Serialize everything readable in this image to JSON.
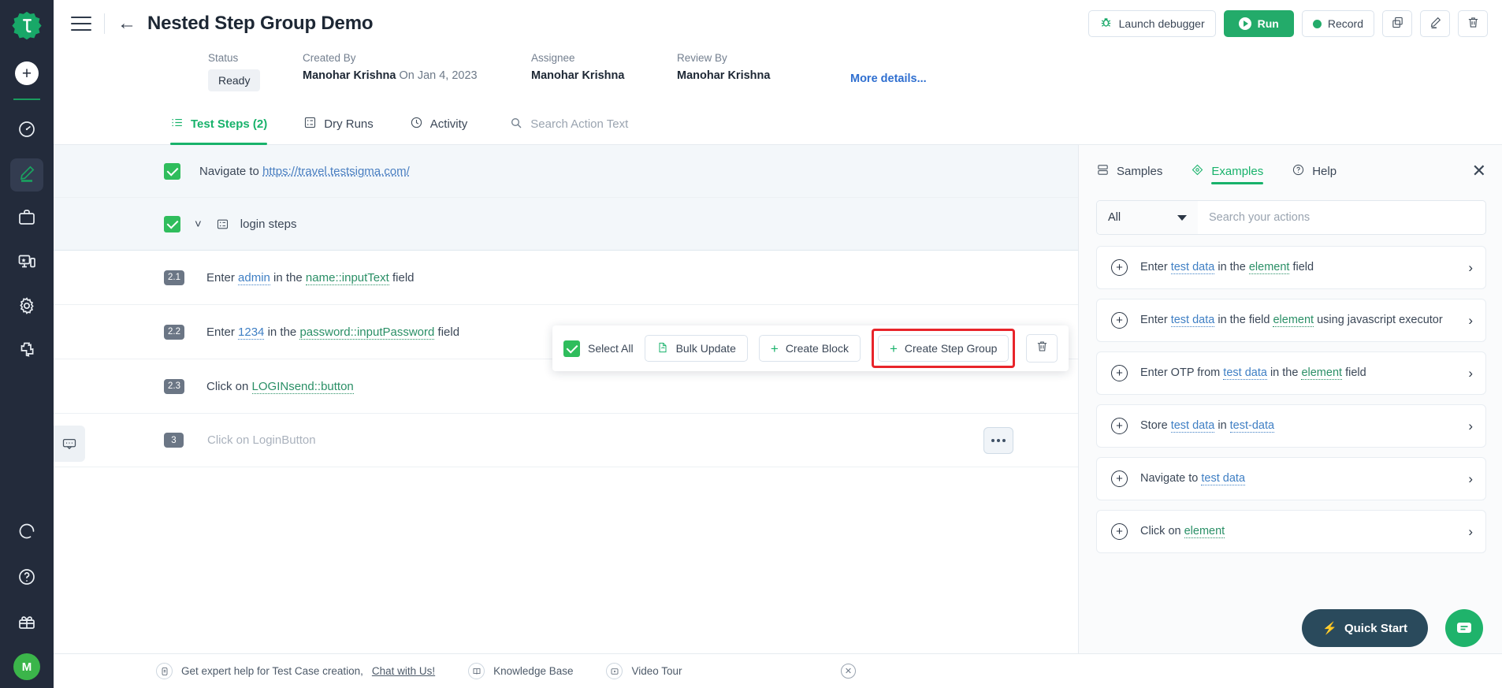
{
  "rail": {
    "logo_icon": "testsigma-logo-icon",
    "add_icon": "plus-icon",
    "items": [
      {
        "name": "dashboard",
        "icon": "speedometer-icon"
      },
      {
        "name": "test-development",
        "icon": "pencil-icon",
        "active": true
      },
      {
        "name": "test-plans",
        "icon": "briefcase-icon"
      },
      {
        "name": "test-lab",
        "icon": "devices-icon"
      },
      {
        "name": "settings",
        "icon": "gear-icon"
      },
      {
        "name": "addons",
        "icon": "puzzle-icon"
      }
    ],
    "bottom_items": [
      {
        "name": "activity",
        "icon": "progress-circle-icon"
      },
      {
        "name": "help",
        "icon": "question-circle-icon"
      },
      {
        "name": "whats-new",
        "icon": "gift-icon"
      }
    ],
    "avatar_initial": "M"
  },
  "header": {
    "title": "Nested Step Group Demo",
    "back_icon": "back-arrow-icon",
    "menu_icon": "hamburger-icon",
    "actions": {
      "launch_debugger": "Launch debugger",
      "run": "Run",
      "record": "Record",
      "copy_icon": "copy-icon",
      "edit_icon": "pencil-edit-icon",
      "delete_icon": "trash-icon"
    }
  },
  "meta": {
    "status_label": "Status",
    "status_value": "Ready",
    "created_by_label": "Created By",
    "created_by_value": "Manohar Krishna",
    "created_on": "On Jan 4, 2023",
    "assignee_label": "Assignee",
    "assignee_value": "Manohar Krishna",
    "review_by_label": "Review By",
    "review_by_value": "Manohar Krishna",
    "more_details": "More details..."
  },
  "tabs": [
    {
      "label": "Test Steps (2)",
      "icon": "list-icon",
      "active": true
    },
    {
      "label": "Dry Runs",
      "icon": "grid-card-icon",
      "active": false
    },
    {
      "label": "Activity",
      "icon": "clock-icon",
      "active": false
    }
  ],
  "search": {
    "placeholder": "Search Action Text",
    "icon": "search-icon"
  },
  "bulkbar": {
    "select_all": "Select All",
    "bulk_update": "Bulk Update",
    "create_block": "Create Block",
    "create_step_group": "Create Step Group",
    "delete_icon": "trash-icon",
    "highlight_color": "#e8242a"
  },
  "steps": [
    {
      "type": "step",
      "checked": true,
      "prefix": "Navigate to",
      "link": "https://travel.testsigma.com/"
    },
    {
      "type": "group",
      "checked": true,
      "expanded": true,
      "chevron_icon": "chevron-down-icon",
      "group_icon": "step-group-icon",
      "label": "login steps"
    },
    {
      "type": "substep",
      "number": "2.1",
      "parts": [
        {
          "t": "Enter ",
          "k": "plain"
        },
        {
          "t": "admin",
          "k": "data"
        },
        {
          "t": " in the ",
          "k": "plain"
        },
        {
          "t": "name::inputText",
          "k": "element"
        },
        {
          "t": " field",
          "k": "plain"
        }
      ]
    },
    {
      "type": "substep",
      "number": "2.2",
      "parts": [
        {
          "t": "Enter ",
          "k": "plain"
        },
        {
          "t": "1234",
          "k": "data"
        },
        {
          "t": " in the ",
          "k": "plain"
        },
        {
          "t": "password::inputPassword",
          "k": "element"
        },
        {
          "t": " field",
          "k": "plain"
        }
      ]
    },
    {
      "type": "substep",
      "number": "2.3",
      "parts": [
        {
          "t": "Click on ",
          "k": "plain"
        },
        {
          "t": "LOGINsend::button",
          "k": "element"
        }
      ]
    },
    {
      "type": "placeholder",
      "number": "3",
      "text": "Click on LoginButton",
      "menu_icon": "more-options-icon"
    }
  ],
  "comment_tab_icon": "comment-icon",
  "right_panel": {
    "tabs": [
      {
        "label": "Samples",
        "icon": "samples-icon",
        "active": false
      },
      {
        "label": "Examples",
        "icon": "examples-icon",
        "active": true
      },
      {
        "label": "Help",
        "icon": "help-circle-icon",
        "active": false
      }
    ],
    "close_icon": "close-icon",
    "filter_value": "All",
    "search_placeholder": "Search your actions",
    "examples": [
      {
        "parts": [
          {
            "t": "Enter ",
            "k": "plain"
          },
          {
            "t": "test data",
            "k": "data"
          },
          {
            "t": " in the ",
            "k": "plain"
          },
          {
            "t": "element",
            "k": "element"
          },
          {
            "t": " field",
            "k": "plain"
          }
        ]
      },
      {
        "parts": [
          {
            "t": "Enter ",
            "k": "plain"
          },
          {
            "t": "test data",
            "k": "data"
          },
          {
            "t": " in the field ",
            "k": "plain"
          },
          {
            "t": "element",
            "k": "element"
          },
          {
            "t": " using javascript executor",
            "k": "plain"
          }
        ]
      },
      {
        "parts": [
          {
            "t": "Enter OTP from ",
            "k": "plain"
          },
          {
            "t": "test data",
            "k": "data"
          },
          {
            "t": " in the ",
            "k": "plain"
          },
          {
            "t": "element",
            "k": "element"
          },
          {
            "t": " field",
            "k": "plain"
          }
        ]
      },
      {
        "parts": [
          {
            "t": "Store ",
            "k": "plain"
          },
          {
            "t": "test data",
            "k": "data"
          },
          {
            "t": " in ",
            "k": "plain"
          },
          {
            "t": "test-data",
            "k": "data"
          }
        ]
      },
      {
        "parts": [
          {
            "t": "Navigate to ",
            "k": "plain"
          },
          {
            "t": "test data",
            "k": "data"
          }
        ]
      },
      {
        "parts": [
          {
            "t": "Click on ",
            "k": "plain"
          },
          {
            "t": "element",
            "k": "element"
          }
        ]
      }
    ]
  },
  "bottom_bar": {
    "expert_text": "Get expert help for Test Case creation,",
    "chat_link": "Chat with Us!",
    "knowledge_base": "Knowledge Base",
    "video_tour": "Video Tour",
    "close_icon": "close-circle-icon"
  },
  "floating": {
    "quick_start": "Quick Start",
    "quick_start_icon": "lightning-icon",
    "chat_icon": "chat-bubble-icon"
  },
  "colors": {
    "brand_green": "#18b26b",
    "run_green": "#23ab6a",
    "rail_bg": "#232b3b",
    "highlight_red": "#e8242a",
    "link_blue": "#2f6fd0"
  }
}
